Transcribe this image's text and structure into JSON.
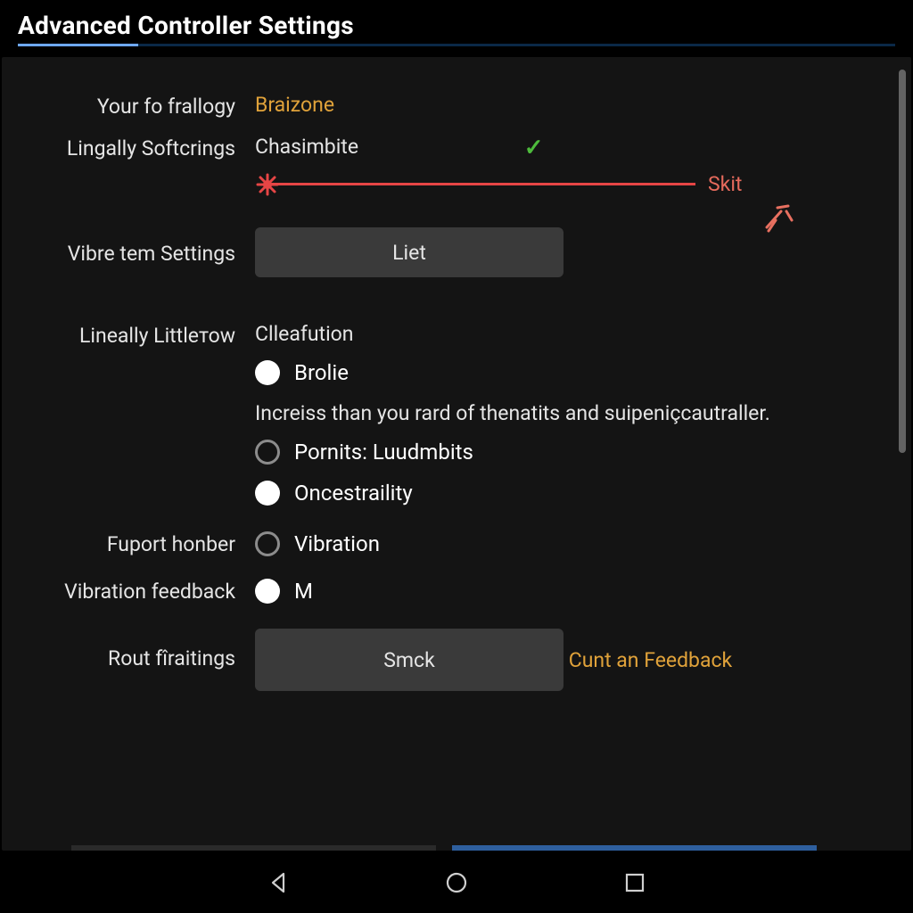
{
  "title": "Advanced Controller Settings",
  "rows": {
    "frallogy": {
      "label": "Your fo frallogy",
      "value": "Braizone"
    },
    "softcrings": {
      "label": "Lingally Softcrings",
      "value": "Chasimbite"
    },
    "slider": {
      "end_label": "Skit"
    },
    "vibretem": {
      "label": "Vibre tem Settings",
      "button": "Liet"
    },
    "littletow": {
      "label": "Lineally Littleтоw",
      "subhead": "Clleafution",
      "desc": "Increiss than you rard of thenatits and suipeniçcautraller.",
      "options": {
        "brolie": "Brolie",
        "pornits": "Pornits: Luudmbits",
        "oncestraility": "Oncestraility"
      }
    },
    "fuport": {
      "label": "Fuport honber",
      "option": "Vibration"
    },
    "vibfeedback": {
      "label": "Vibration feedback",
      "option": "M"
    },
    "rout": {
      "label": "Rout fîraitings",
      "button": "Smck",
      "link": "Cunt an Feedback"
    }
  },
  "colors": {
    "accent_gold": "#e0a23a",
    "slider_red": "#e64545",
    "check_green": "#4dbb3c"
  }
}
